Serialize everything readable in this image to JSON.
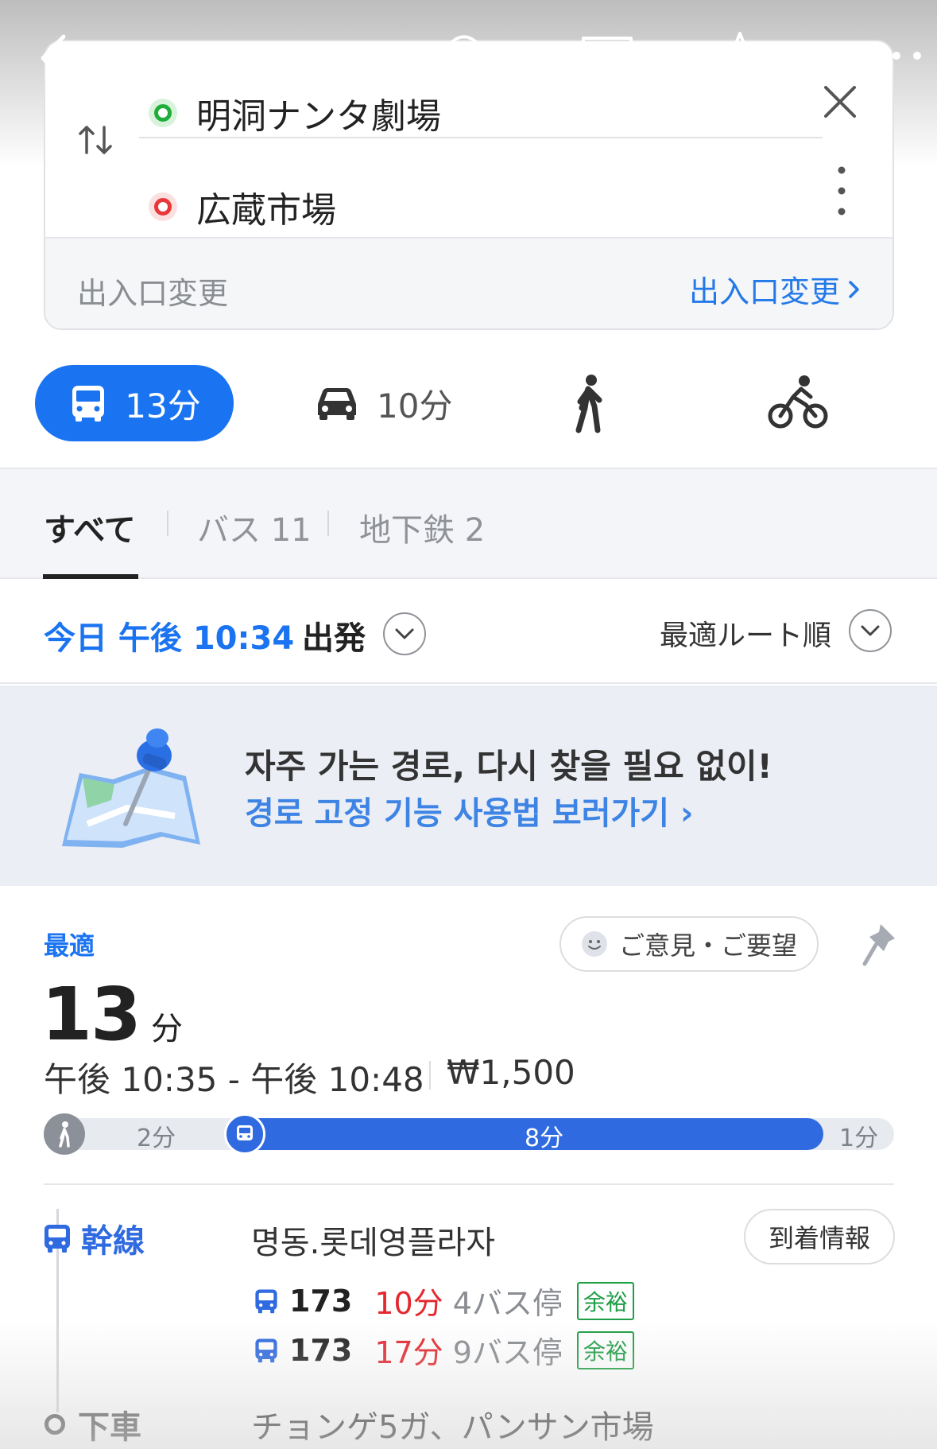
{
  "search": {
    "origin": "明洞ナンタ劇場",
    "destination": "広蔵市場",
    "entrance_label": "出入口変更",
    "entrance_link": "出入口変更"
  },
  "modes": {
    "transit_time": "13分",
    "car_time": "10分"
  },
  "filters": {
    "all": "すべて",
    "bus": "バス 11",
    "subway": "地下鉄 2"
  },
  "departure": {
    "time": "今日 午後 10:34",
    "label": "出発",
    "sort": "最適ルート順"
  },
  "promo": {
    "title": "자주 가는 경로, 다시 찾을 필요 없이!",
    "link": "경로 고정 기능 사용법 보러가기 ›"
  },
  "route": {
    "badge": "最適",
    "feedback": "ご意見・ご要望",
    "duration_value": "13",
    "duration_unit": "分",
    "time_range": "午後 10:35 - 午後 10:48",
    "fare": "₩1,500",
    "segments": {
      "walk_start": "2分",
      "bus": "8分",
      "walk_end": "1分"
    },
    "board": {
      "type": "幹線",
      "stop": "명동.롯데영플라자",
      "arrival_button": "到着情報",
      "buses": [
        {
          "number": "173",
          "eta": "10分",
          "stops": "4バス停",
          "status": "余裕"
        },
        {
          "number": "173",
          "eta": "17分",
          "stops": "9バス停",
          "status": "余裕"
        }
      ]
    },
    "alight": {
      "label": "下車",
      "stop": "チョンゲ5ガ、パンサン市場"
    }
  },
  "colors": {
    "accent": "#1a73f0",
    "bus_line": "#2f6ae0",
    "eta_red": "#e3282e",
    "status_green": "#1e9e45"
  }
}
